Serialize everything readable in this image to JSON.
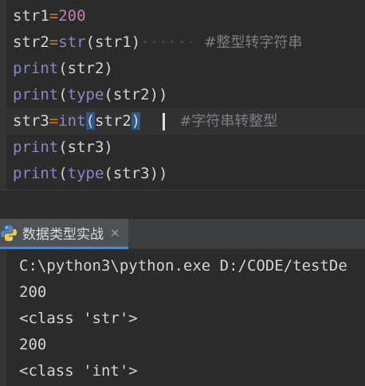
{
  "editor": {
    "lines": [
      {
        "a": "str1",
        "b": "=",
        "c": "200",
        "d": "",
        "e": ""
      },
      {
        "a": "str2",
        "b": "=",
        "c": "str",
        "d": "(str1)",
        "ws": "······",
        "comment": "#整型转字符串"
      },
      {
        "a": "print",
        "d": "(str2)"
      },
      {
        "a": "print",
        "b": "(",
        "c": "type",
        "d": "(str2))"
      },
      {
        "a": "str3",
        "b": "=",
        "c": "int",
        "p_open": "(",
        "d": "str2",
        "p_close": ")",
        "comment": "#字符串转整型"
      },
      {
        "a": "print",
        "d": "(str3)"
      },
      {
        "a": "print",
        "b": "(",
        "c": "type",
        "d": "(str3))"
      }
    ]
  },
  "run": {
    "tab_label": "数据类型实战",
    "close_glyph": "✕",
    "icon": "python-icon"
  },
  "console": {
    "lines": [
      "C:\\python3\\python.exe D:/CODE/testDe",
      "200",
      "<class 'str'>",
      "200",
      "<class 'int'>"
    ]
  },
  "colors": {
    "background": "#2b2b2b",
    "builtin": "#8888c6",
    "number": "#c77dbb",
    "operator": "#cc7832",
    "comment": "#7a7e85",
    "tab_underline": "#4a88c7"
  }
}
